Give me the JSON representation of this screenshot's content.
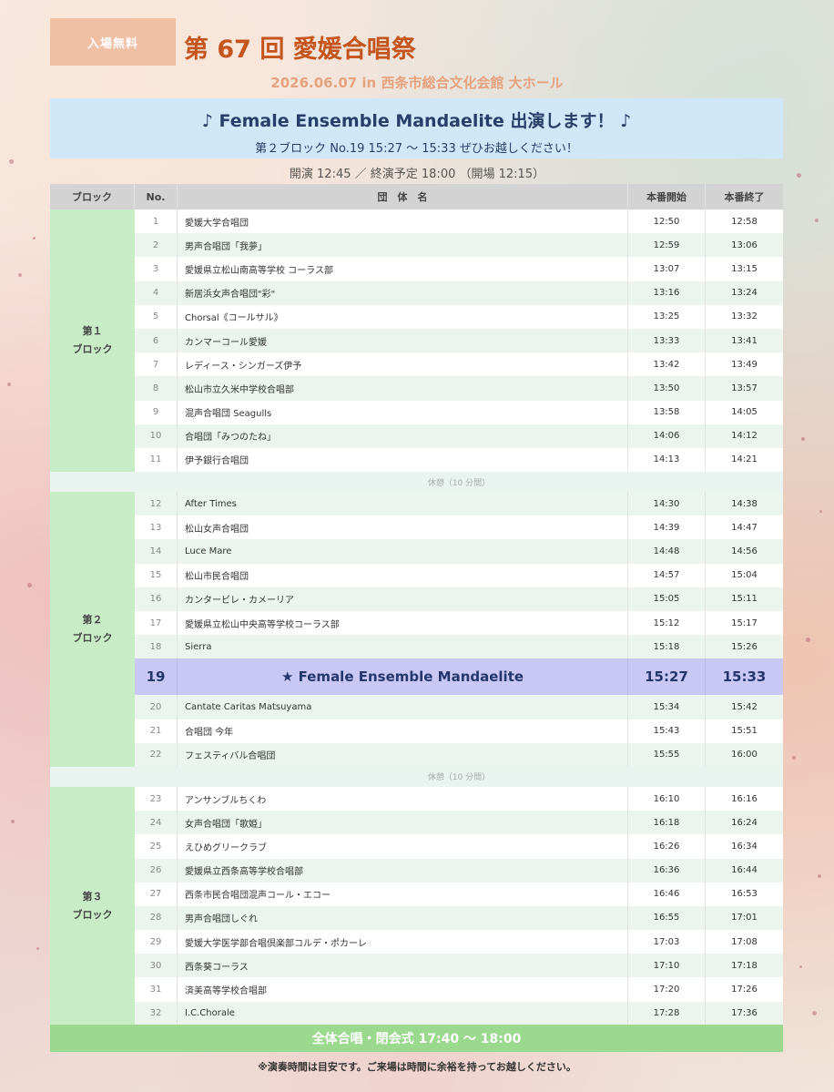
{
  "badge": "入場無料",
  "title": "第 67 回 愛媛合唱祭",
  "subtitle": "2026.06.07  in  西条市総合文化会館  大ホール",
  "announce": {
    "main": "♪  Female Ensemble Mandaelite  出演します！  ♪",
    "sub": "第２ブロック    No.19    15:27 ～ 15:33    ぜひお越しください！"
  },
  "times_line": "開演 12:45    ／    終演予定 18:00    （開場 12:15）",
  "headers": {
    "block": "ブロック",
    "no": "No.",
    "name": "団　体　名",
    "start": "本番開始",
    "end": "本番終了"
  },
  "blocks": [
    {
      "line1": "第１",
      "line2": "ブロック"
    },
    {
      "line1": "第２",
      "line2": "ブロック"
    },
    {
      "line1": "第３",
      "line2": "ブロック"
    }
  ],
  "break_label": "休憩（10 分間）",
  "rows": [
    {
      "no": "1",
      "name": "愛媛大学合唱団",
      "start": "12:50",
      "end": "12:58"
    },
    {
      "no": "2",
      "name": "男声合唱団「我夢」",
      "start": "12:59",
      "end": "13:06"
    },
    {
      "no": "3",
      "name": "愛媛県立松山南高等学校 コーラス部",
      "start": "13:07",
      "end": "13:15"
    },
    {
      "no": "4",
      "name": "新居浜女声合唱団\"彩\"",
      "start": "13:16",
      "end": "13:24"
    },
    {
      "no": "5",
      "name": "Chorsal《コールサル》",
      "start": "13:25",
      "end": "13:32"
    },
    {
      "no": "6",
      "name": "カンマーコール愛媛",
      "start": "13:33",
      "end": "13:41"
    },
    {
      "no": "7",
      "name": "レディース・シンガーズ伊予",
      "start": "13:42",
      "end": "13:49"
    },
    {
      "no": "8",
      "name": "松山市立久米中学校合唱部",
      "start": "13:50",
      "end": "13:57"
    },
    {
      "no": "9",
      "name": "混声合唱団 Seagulls",
      "start": "13:58",
      "end": "14:05"
    },
    {
      "no": "10",
      "name": "合唱団「みつのたね」",
      "start": "14:06",
      "end": "14:12"
    },
    {
      "no": "11",
      "name": "伊予銀行合唱団",
      "start": "14:13",
      "end": "14:21"
    },
    {
      "no": "12",
      "name": "After Times",
      "start": "14:30",
      "end": "14:38"
    },
    {
      "no": "13",
      "name": "松山女声合唱団",
      "start": "14:39",
      "end": "14:47"
    },
    {
      "no": "14",
      "name": "Luce Mare",
      "start": "14:48",
      "end": "14:56"
    },
    {
      "no": "15",
      "name": "松山市民合唱団",
      "start": "14:57",
      "end": "15:04"
    },
    {
      "no": "16",
      "name": "カンタービレ・カメーリア",
      "start": "15:05",
      "end": "15:11"
    },
    {
      "no": "17",
      "name": "愛媛県立松山中央高等学校コーラス部",
      "start": "15:12",
      "end": "15:17"
    },
    {
      "no": "18",
      "name": "Sierra",
      "start": "15:18",
      "end": "15:26"
    },
    {
      "no": "19",
      "name": "★ Female Ensemble Mandaelite",
      "start": "15:27",
      "end": "15:33"
    },
    {
      "no": "20",
      "name": "Cantate Caritas Matsuyama",
      "start": "15:34",
      "end": "15:42"
    },
    {
      "no": "21",
      "name": "合唱団 今年",
      "start": "15:43",
      "end": "15:51"
    },
    {
      "no": "22",
      "name": "フェスティバル合唱団",
      "start": "15:55",
      "end": "16:00"
    },
    {
      "no": "23",
      "name": "アンサンブルちくわ",
      "start": "16:10",
      "end": "16:16"
    },
    {
      "no": "24",
      "name": "女声合唱団「歌姫」",
      "start": "16:18",
      "end": "16:24"
    },
    {
      "no": "25",
      "name": "えひめグリークラブ",
      "start": "16:26",
      "end": "16:34"
    },
    {
      "no": "26",
      "name": "愛媛県立西条高等学校合唱部",
      "start": "16:36",
      "end": "16:44"
    },
    {
      "no": "27",
      "name": "西条市民合唱団混声コール・エコー",
      "start": "16:46",
      "end": "16:53"
    },
    {
      "no": "28",
      "name": "男声合唱団しぐれ",
      "start": "16:55",
      "end": "17:01"
    },
    {
      "no": "29",
      "name": "愛媛大学医学部合唱倶楽部コルデ・ポカーレ",
      "start": "17:03",
      "end": "17:08"
    },
    {
      "no": "30",
      "name": "西条葵コーラス",
      "start": "17:10",
      "end": "17:18"
    },
    {
      "no": "31",
      "name": "済美高等学校合唱部",
      "start": "17:20",
      "end": "17:26"
    },
    {
      "no": "32",
      "name": "I.C.Chorale",
      "start": "17:28",
      "end": "17:36"
    }
  ],
  "closing": "全体合唱・閉会式    17:40 ～ 18:00",
  "footnote": "※演奏時間は目安です。ご来場は時間に余裕を持ってお越しください。"
}
